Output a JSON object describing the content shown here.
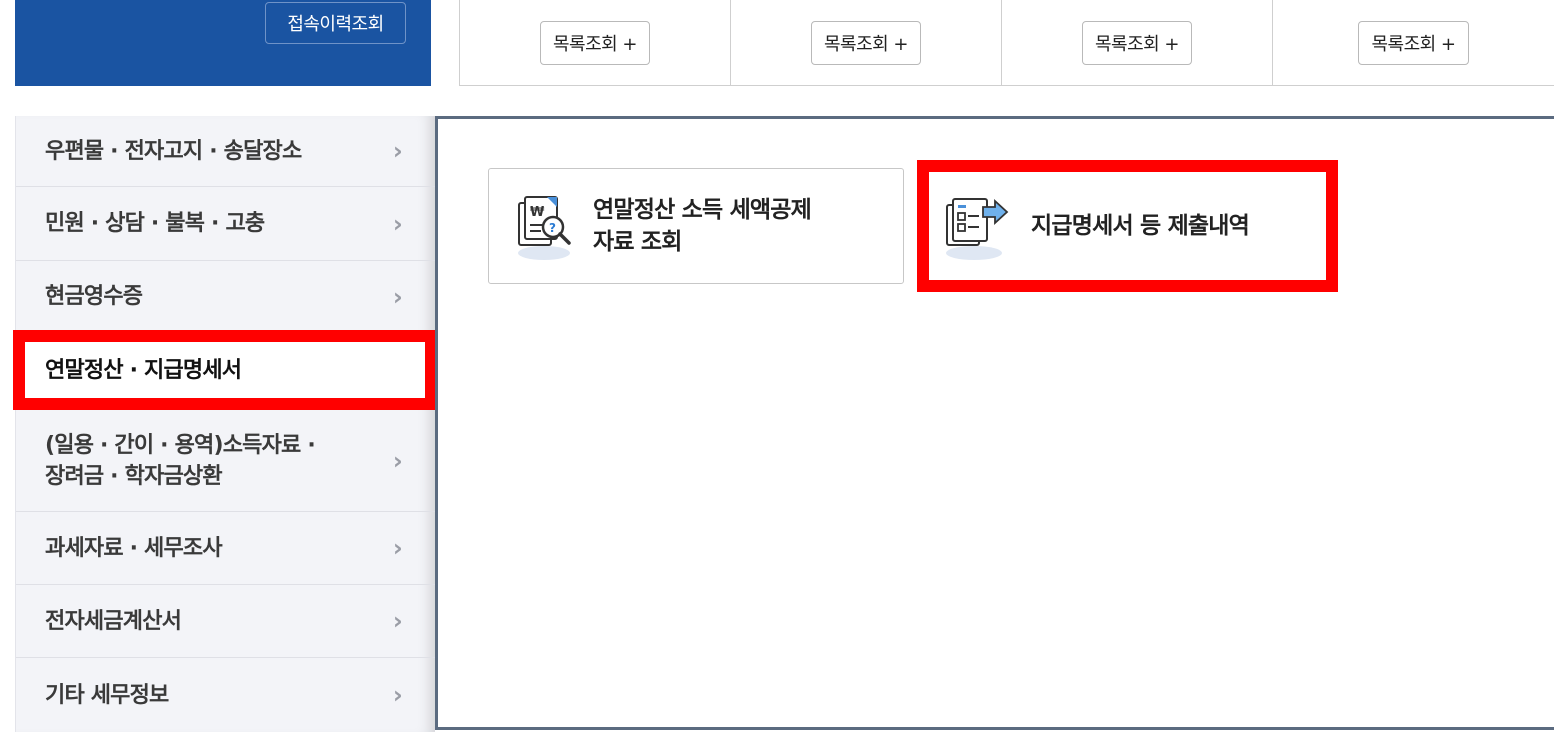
{
  "header": {
    "history_button": "접속이력조회",
    "list_buttons": [
      "목록조회 +",
      "목록조회 +",
      "목록조회 +",
      "목록조회 +"
    ]
  },
  "sidebar": {
    "items": [
      {
        "label": "우편물 · 전자고지 · 송달장소",
        "active": false
      },
      {
        "label": "민원 · 상담 · 불복 · 고충",
        "active": false
      },
      {
        "label": "현금영수증",
        "active": false
      },
      {
        "label": "연말정산 · 지급명세서",
        "active": true
      },
      {
        "label": "(일용 · 간이 · 용역)소득자료 ·",
        "label2": "장려금 · 학자금상환",
        "active": false
      },
      {
        "label": "과세자료 · 세무조사",
        "active": false
      },
      {
        "label": "전자세금계산서",
        "active": false
      },
      {
        "label": "기타 세무정보",
        "active": false
      }
    ]
  },
  "main": {
    "cards": [
      {
        "line1": "연말정산 소득 세액공제",
        "line2": "자료 조회",
        "icon": "document-search-icon"
      },
      {
        "line1": "지급명세서 등 제출내역",
        "icon": "document-send-icon"
      }
    ]
  },
  "colors": {
    "brand_blue": "#1a54a2",
    "highlight_red": "#ff0000",
    "panel_border": "#5b6b80"
  }
}
